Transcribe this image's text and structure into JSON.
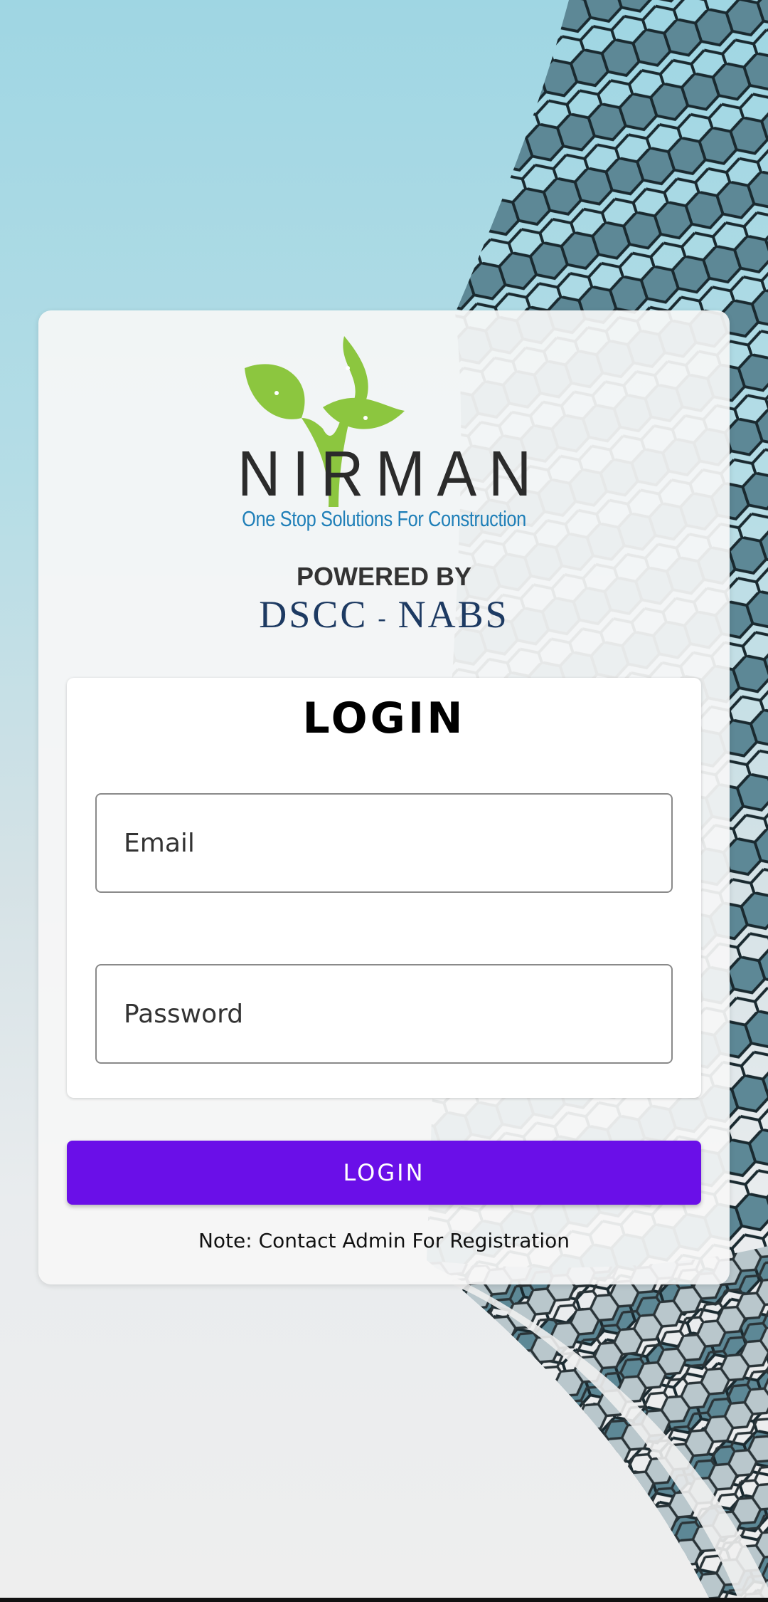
{
  "brand": {
    "logo_text": "NIRMAN",
    "tagline": "One Stop Solutions For Construction",
    "powered_by": "POWERED BY",
    "org_left": "DSCC",
    "org_sep": "-",
    "org_right": "NABS"
  },
  "form": {
    "title": "LOGIN",
    "email_placeholder": "Email",
    "password_placeholder": "Password"
  },
  "actions": {
    "login_label": "LOGIN"
  },
  "note": "Note: Contact Admin For Registration",
  "colors": {
    "accent": "#6a0fe8",
    "logo_green": "#8cc63f",
    "tagline_blue": "#1f7fb8",
    "org_navy": "#1d3a62"
  }
}
